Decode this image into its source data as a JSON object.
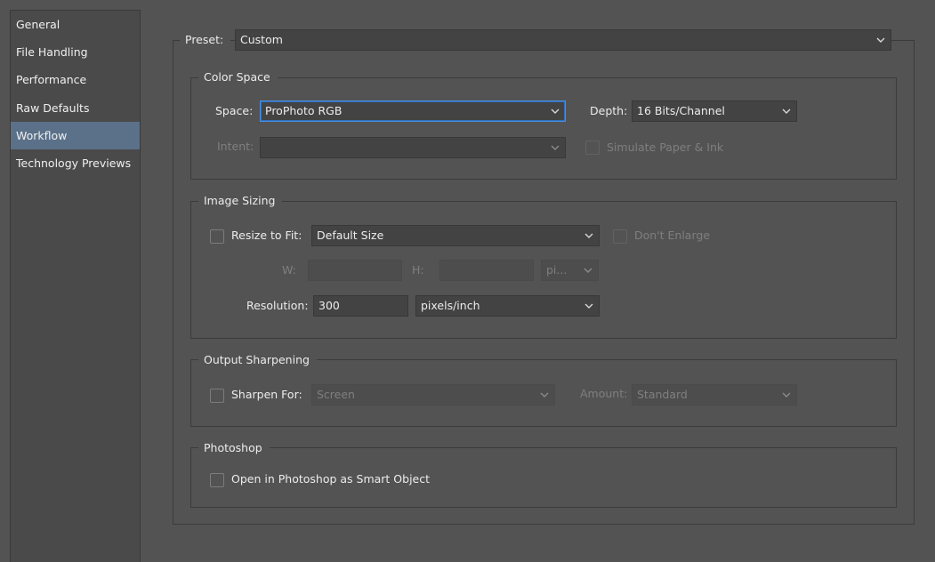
{
  "sidebar": {
    "items": [
      {
        "label": "General",
        "active": false
      },
      {
        "label": "File Handling",
        "active": false
      },
      {
        "label": "Performance",
        "active": false
      },
      {
        "label": "Raw Defaults",
        "active": false
      },
      {
        "label": "Workflow",
        "active": true
      },
      {
        "label": "Technology Previews",
        "active": false
      }
    ]
  },
  "preset": {
    "label": "Preset:",
    "value": "Custom"
  },
  "color_space": {
    "title": "Color Space",
    "space_label": "Space:",
    "space_value": "ProPhoto RGB",
    "depth_label": "Depth:",
    "depth_value": "16 Bits/Channel",
    "intent_label": "Intent:",
    "intent_value": "",
    "simulate_label": "Simulate Paper & Ink",
    "simulate_checked": false
  },
  "image_sizing": {
    "title": "Image Sizing",
    "resize_label": "Resize to Fit:",
    "resize_checked": false,
    "resize_value": "Default Size",
    "dont_enlarge_label": "Don't Enlarge",
    "dont_enlarge_checked": false,
    "w_label": "W:",
    "w_value": "",
    "h_label": "H:",
    "h_value": "",
    "unit_value": "pi...",
    "resolution_label": "Resolution:",
    "resolution_value": "300",
    "resolution_unit": "pixels/inch"
  },
  "output_sharpening": {
    "title": "Output Sharpening",
    "sharpen_label": "Sharpen For:",
    "sharpen_checked": false,
    "sharpen_value": "Screen",
    "amount_label": "Amount:",
    "amount_value": "Standard"
  },
  "photoshop": {
    "title": "Photoshop",
    "smart_object_label": "Open in Photoshop as Smart Object",
    "smart_object_checked": false
  },
  "colors": {
    "background": "#535353",
    "sidebar_bg": "#4a4a4a",
    "active_item": "#5b7189",
    "focus_border": "#4b8fdf"
  }
}
